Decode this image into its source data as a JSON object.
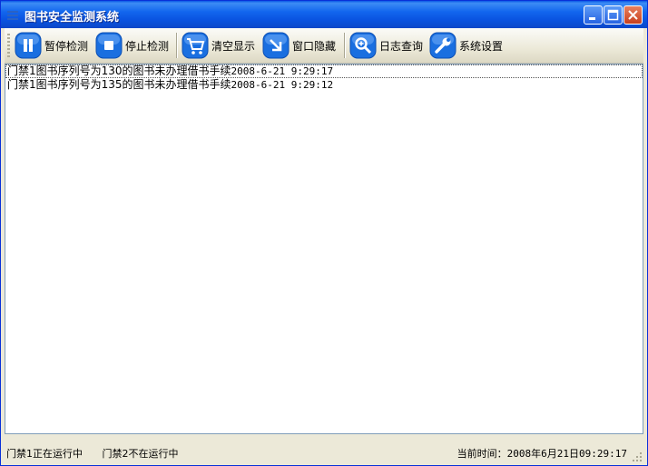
{
  "window": {
    "title": "图书安全监测系统"
  },
  "toolbar": {
    "pause_label": "暂停检测",
    "stop_label": "停止检测",
    "clear_label": "清空显示",
    "hide_label": "窗口隐藏",
    "log_label": "日志查询",
    "settings_label": "系统设置"
  },
  "log": {
    "items": [
      {
        "message": "门禁1图书序列号为130的图书未办理借书手续",
        "time": "2008-6-21 9:29:17"
      },
      {
        "message": "门禁1图书序列号为135的图书未办理借书手续",
        "time": "2008-6-21 9:29:12"
      }
    ]
  },
  "status": {
    "gate1": "门禁1正在运行中",
    "gate2": "门禁2不在运行中",
    "time_label": "当前时间：",
    "time_value": "2008年6月21日09:29:17"
  },
  "colors": {
    "titlebar": "#0a53e0",
    "button_blue": "#1a6fe0",
    "selection": "#316ac5"
  }
}
